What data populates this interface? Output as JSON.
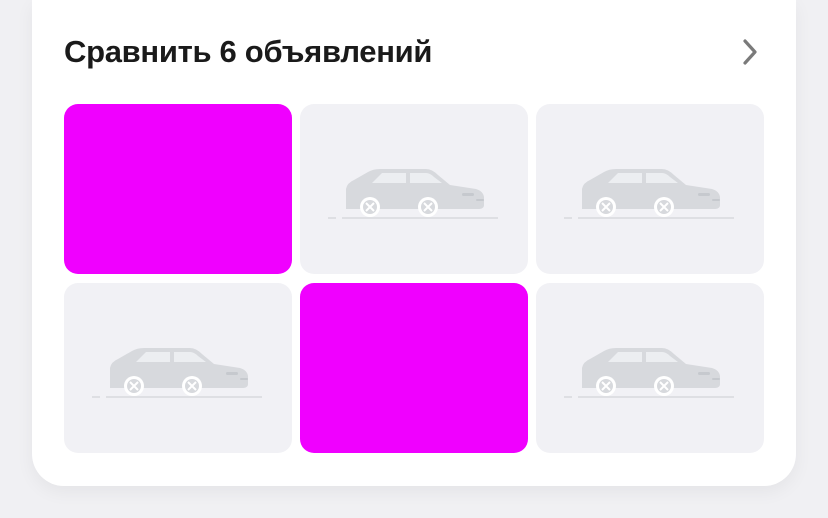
{
  "compare": {
    "title": "Сравнить 6 объявлений",
    "chevron_icon": "chevron-right-icon",
    "colors": {
      "image_fill": "#f000ff",
      "placeholder_bg": "#f1f1f5",
      "placeholder_car": "#d7d9dd"
    },
    "tiles": [
      {
        "kind": "image"
      },
      {
        "kind": "placeholder",
        "icon": "car-placeholder-icon"
      },
      {
        "kind": "placeholder",
        "icon": "car-placeholder-icon"
      },
      {
        "kind": "placeholder",
        "icon": "car-placeholder-icon"
      },
      {
        "kind": "image"
      },
      {
        "kind": "placeholder",
        "icon": "car-placeholder-icon"
      }
    ]
  }
}
